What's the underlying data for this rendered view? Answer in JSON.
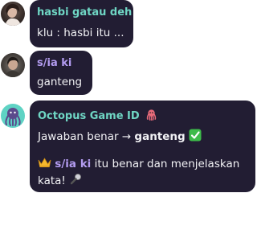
{
  "messages": [
    {
      "username": "hasbi gatau deh",
      "username_color": "#6fd6c4",
      "text": "klu : hasbi itu ..."
    },
    {
      "username": "s/ia ki",
      "username_color": "#b39cf0",
      "text": "ganteng"
    },
    {
      "username": "Octopus Game ID",
      "username_color": "#6fd6c4",
      "username_icon": "octopus-icon",
      "answer_prefix": "Jawaban benar",
      "arrow": "→",
      "answer": "ganteng",
      "answer_icon": "check-mark-icon",
      "winner_icon": "crown-icon",
      "winner_name": "s/ia ki",
      "winner_text_1": "itu benar dan menjelaskan",
      "winner_text_2": "kata!",
      "mic_icon": "microphone-icon"
    }
  ],
  "colors": {
    "bubble": "#221d33",
    "text": "#f2f2f5",
    "check_green": "#3dbb4a",
    "crown_gold": "#f5b82e",
    "octopus": "#e86a7a"
  }
}
